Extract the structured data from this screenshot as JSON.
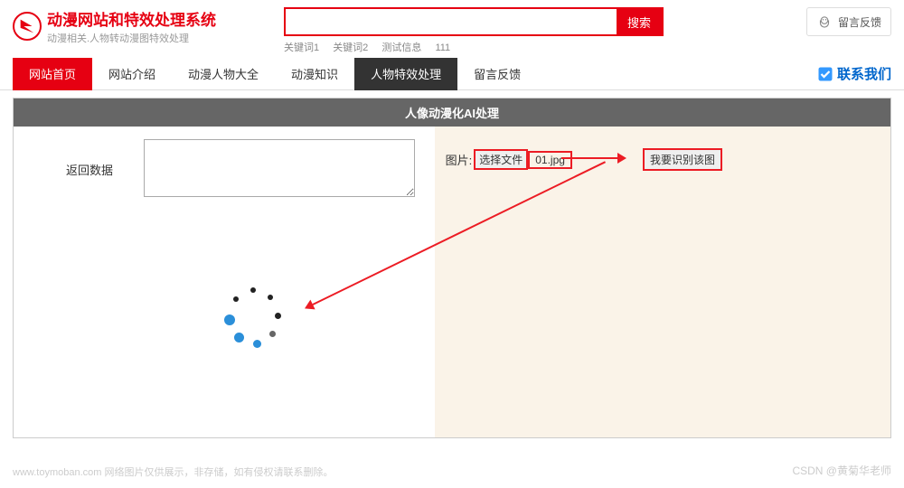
{
  "header": {
    "title": "动漫网站和特效处理系统",
    "subtitle": "动漫相关.人物转动漫图特效处理",
    "search_button": "搜索",
    "search_placeholder": "",
    "keywords": [
      "关键词1",
      "关键词2",
      "测试信息",
      "111"
    ],
    "feedback_label": "留言反馈"
  },
  "nav": {
    "items": [
      {
        "label": "网站首页",
        "variant": "active-red"
      },
      {
        "label": "网站介绍",
        "variant": ""
      },
      {
        "label": "动漫人物大全",
        "variant": ""
      },
      {
        "label": "动漫知识",
        "variant": ""
      },
      {
        "label": "人物特效处理",
        "variant": "active-black"
      },
      {
        "label": "留言反馈",
        "variant": ""
      }
    ],
    "contact": "联系我们"
  },
  "panel": {
    "title": "人像动漫化AI处理",
    "return_label": "返回数据",
    "return_value": "",
    "upload_label": "图片:",
    "file_button": "选择文件",
    "file_name": "01.jpg",
    "recognize_button": "我要识别该图"
  },
  "watermark": {
    "left": "www.toymoban.com 网络图片仅供展示，非存储，如有侵权请联系删除。",
    "right": "CSDN @黄菊华老师"
  }
}
